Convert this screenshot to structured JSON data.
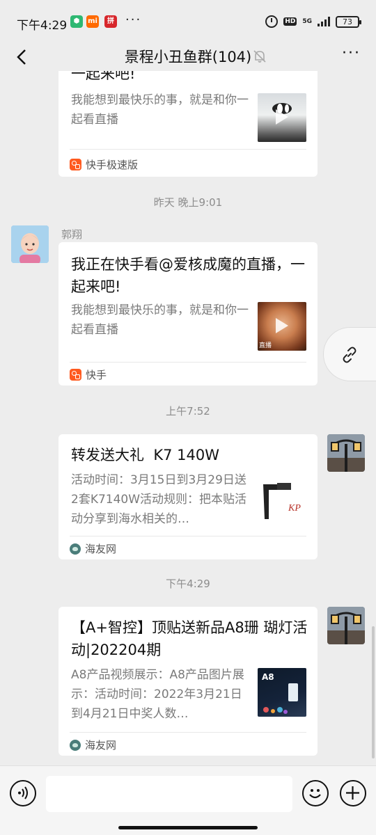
{
  "status_bar": {
    "time": "下午4:29",
    "app_badges": [
      "vpn-badge-icon",
      "mi-icon",
      "pinduoduo-icon"
    ],
    "network": "5G",
    "hd": "HD",
    "battery": "73",
    "more": "···"
  },
  "header": {
    "title": "景程小丑鱼群(104)",
    "more": "···"
  },
  "messages": [
    {
      "type": "share-card",
      "title_partial": "一起来吧!",
      "desc": "我能想到最快乐的事，就是和你一起看直播",
      "source": "快手极速版",
      "source_icon": "kuaishou-icon"
    },
    {
      "type": "timestamp",
      "text": "昨天 晚上9:01"
    },
    {
      "type": "share-card",
      "sender": "郭翔",
      "title": "我正在快手看@爱核成魔的直播，一起来吧!",
      "desc": "我能想到最快乐的事，就是和你一起看直播",
      "thumb_caption": "直播",
      "source": "快手",
      "source_icon": "kuaishou-icon"
    },
    {
      "type": "timestamp",
      "text": "上午7:52"
    },
    {
      "type": "share-card",
      "title": "转发送大礼  K7 140W",
      "desc": "活动时间：3月15日到3月29日送2套K7140W活动规则：把本贴活动分享到海水相关的…",
      "source": "海友网",
      "source_icon": "haiyou-icon"
    },
    {
      "type": "timestamp",
      "text": "下午4:29"
    },
    {
      "type": "share-card",
      "title": "【A+智控】顶贴送新品A8珊 瑚灯活动|202204期",
      "desc": "A8产品视频展示：A8产品图片展示：活动时间：2022年3月21日到4月21日中奖人数…",
      "thumb_label": "A8",
      "source": "海友网",
      "source_icon": "haiyou-icon"
    }
  ],
  "input": {
    "value": "",
    "placeholder": ""
  },
  "colors": {
    "background": "#ededed",
    "card": "#ffffff",
    "muted_text": "#8c8c8c",
    "kuaishou_orange": "#ff5a1f"
  }
}
